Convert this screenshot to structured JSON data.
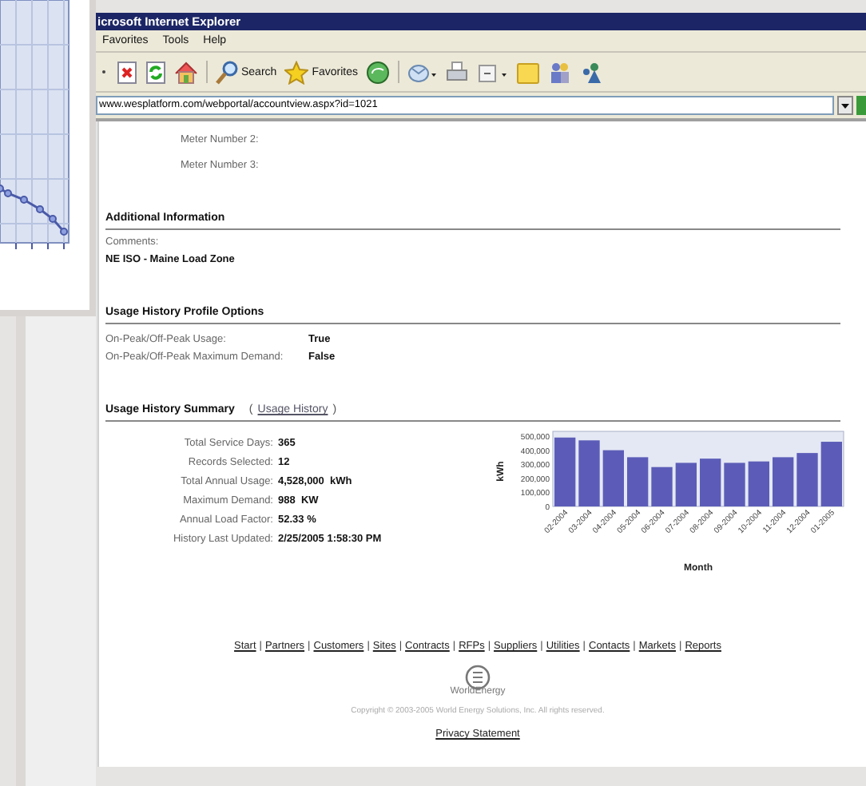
{
  "window": {
    "title": "icrosoft Internet Explorer"
  },
  "menu": [
    "Favorites",
    "Tools",
    "Help"
  ],
  "toolbar": {
    "search": "Search",
    "favorites": "Favorites"
  },
  "address": "www.wesplatform.com/webportal/accountview.aspx?id=1021",
  "meters": [
    "Meter Number 2:",
    "Meter Number 3:"
  ],
  "additional": {
    "heading": "Additional Information",
    "comments_label": "Comments:",
    "comments": "NE ISO - Maine Load Zone"
  },
  "profile": {
    "heading": "Usage History Profile Options",
    "rows": [
      {
        "label": "On-Peak/Off-Peak Usage:",
        "value": "True"
      },
      {
        "label": "On-Peak/Off-Peak Maximum Demand:",
        "value": "False"
      }
    ]
  },
  "summary": {
    "heading": "Usage History Summary",
    "link_open": "(",
    "link": "Usage History",
    "link_close": ")",
    "rows": [
      {
        "label": "Total Service Days:",
        "value": "365"
      },
      {
        "label": "Records Selected:",
        "value": "12"
      },
      {
        "label": "Total Annual Usage:",
        "value": "4,528,000  kWh"
      },
      {
        "label": "Maximum Demand:",
        "value": "988  KW"
      },
      {
        "label": "Annual Load Factor:",
        "value": "52.33 %"
      },
      {
        "label": "History Last Updated:",
        "value": "2/25/2005 1:58:30 PM"
      }
    ],
    "chart_data": {
      "type": "bar",
      "xlabel": "Month",
      "ylabel": "kWh",
      "categories": [
        "02-2004",
        "03-2004",
        "04-2004",
        "05-2004",
        "06-2004",
        "07-2004",
        "08-2004",
        "09-2004",
        "10-2004",
        "11-2004",
        "12-2004",
        "01-2005"
      ],
      "series": [
        {
          "color": "#5c5cb8",
          "values": [
            490000,
            470000,
            400000,
            350000,
            280000,
            310000,
            340000,
            310000,
            320000,
            350000,
            380000,
            460000
          ]
        }
      ],
      "ylim": [
        0,
        500000
      ],
      "yticks": [
        {
          "value": 0,
          "label": "0"
        },
        {
          "value": 100000,
          "label": "100,000"
        },
        {
          "value": 200000,
          "label": "200,000"
        },
        {
          "value": 300000,
          "label": "300,000"
        },
        {
          "value": 400000,
          "label": "400,000"
        },
        {
          "value": 500000,
          "label": "500,000"
        }
      ]
    }
  },
  "footer": {
    "separator": "|",
    "links": [
      "Start",
      "Partners",
      "Customers",
      "Sites",
      "Contracts",
      "RFPs",
      "Suppliers",
      "Utilities",
      "Contacts",
      "Markets",
      "Reports"
    ],
    "logo": "WorldEnergy",
    "copyright": "Copyright © 2003-2005 World Energy Solutions, Inc. All rights reserved.",
    "privacy": "Privacy Statement"
  }
}
